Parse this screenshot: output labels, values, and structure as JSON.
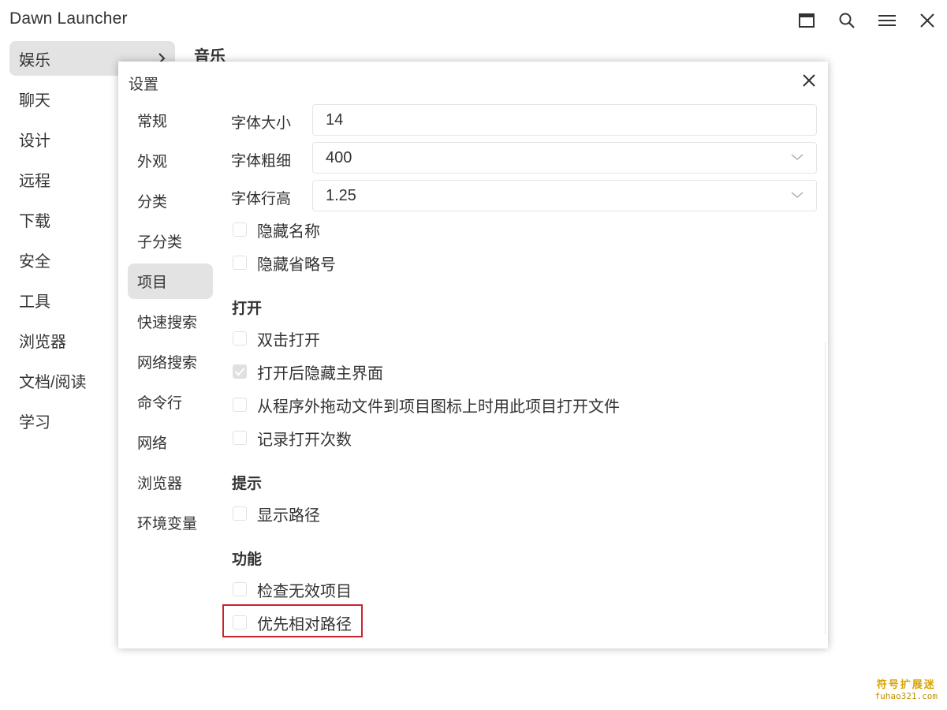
{
  "app": {
    "title": "Dawn Launcher"
  },
  "titlebar_icons": [
    "window-maximize-icon",
    "search-icon",
    "menu-icon",
    "close-icon"
  ],
  "sidebar": {
    "items": [
      {
        "label": "娱乐",
        "active": true
      },
      {
        "label": "聊天"
      },
      {
        "label": "设计"
      },
      {
        "label": "远程"
      },
      {
        "label": "下载"
      },
      {
        "label": "安全"
      },
      {
        "label": "工具"
      },
      {
        "label": "浏览器"
      },
      {
        "label": "文档/阅读"
      },
      {
        "label": "学习"
      }
    ]
  },
  "content": {
    "title": "音乐"
  },
  "dialog": {
    "title": "设置",
    "nav": [
      {
        "label": "常规"
      },
      {
        "label": "外观"
      },
      {
        "label": "分类"
      },
      {
        "label": "子分类"
      },
      {
        "label": "项目",
        "active": true
      },
      {
        "label": "快速搜索"
      },
      {
        "label": "网络搜索"
      },
      {
        "label": "命令行"
      },
      {
        "label": "网络"
      },
      {
        "label": "浏览器"
      },
      {
        "label": "环境变量"
      }
    ],
    "fields": {
      "font_size": {
        "label": "字体大小",
        "value": "14"
      },
      "font_weight": {
        "label": "字体粗细",
        "value": "400"
      },
      "line_height": {
        "label": "字体行高",
        "value": "1.25"
      }
    },
    "display_options": [
      {
        "label": "隐藏名称",
        "checked": false
      },
      {
        "label": "隐藏省略号",
        "checked": false
      }
    ],
    "sections": {
      "open": {
        "title": "打开",
        "options": [
          {
            "label": "双击打开",
            "checked": false
          },
          {
            "label": "打开后隐藏主界面",
            "checked": true
          },
          {
            "label": "从程序外拖动文件到项目图标上时用此项目打开文件",
            "checked": false
          },
          {
            "label": "记录打开次数",
            "checked": false
          }
        ]
      },
      "tips": {
        "title": "提示",
        "options": [
          {
            "label": "显示路径",
            "checked": false
          }
        ]
      },
      "features": {
        "title": "功能",
        "options": [
          {
            "label": "检查无效项目",
            "checked": false
          },
          {
            "label": "优先相对路径",
            "checked": false
          }
        ]
      }
    }
  },
  "watermark": {
    "title": "符号扩展迷",
    "url": "fuhao321.com"
  },
  "colors": {
    "highlight": "#c8242c",
    "active_bg": "#e3e3e3",
    "watermark": "#d9a300"
  }
}
